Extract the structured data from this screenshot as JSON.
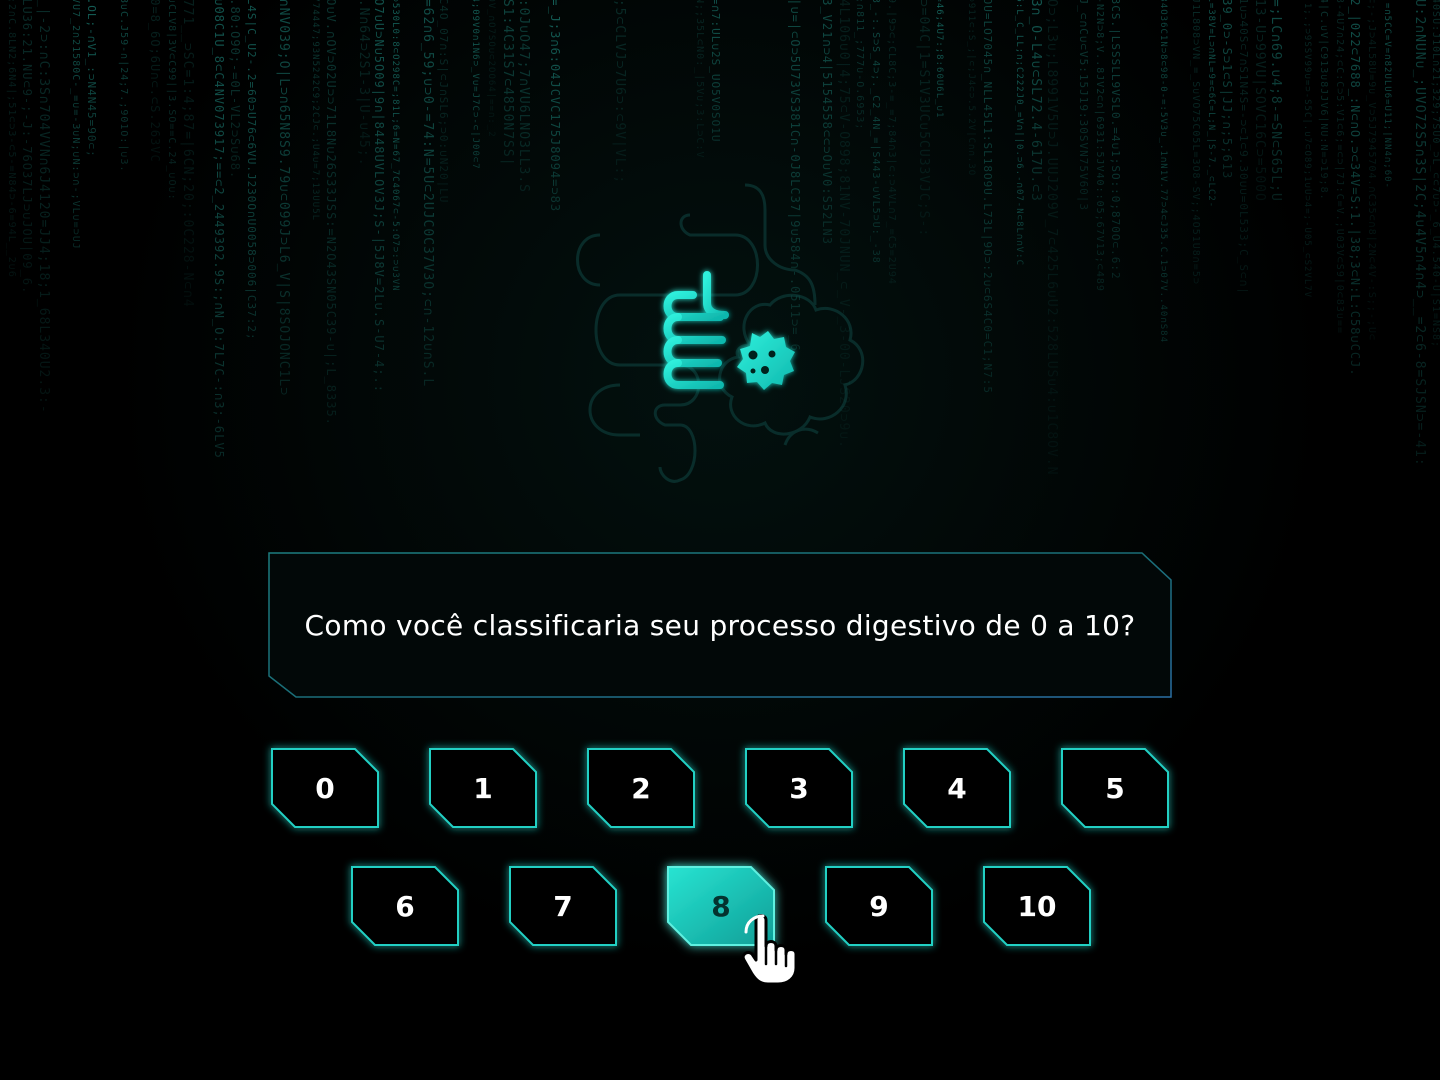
{
  "question": "Como você classificaria seu processo digestivo de 0 a 10?",
  "rating_options": [
    "0",
    "1",
    "2",
    "3",
    "4",
    "5",
    "6",
    "7",
    "8",
    "9",
    "10"
  ],
  "selected_option": "8",
  "colors": {
    "accent": "#1fd6c6",
    "accent_light": "#5ff0e0",
    "accent_dark": "#0f8f8a",
    "panel_border": "#1e8d8f",
    "background": "#000000",
    "matrix": "#1f8f84"
  },
  "icons": {
    "hero": "intestine-bacteria-icon",
    "pointer": "hand-pointer-cursor-icon"
  }
}
